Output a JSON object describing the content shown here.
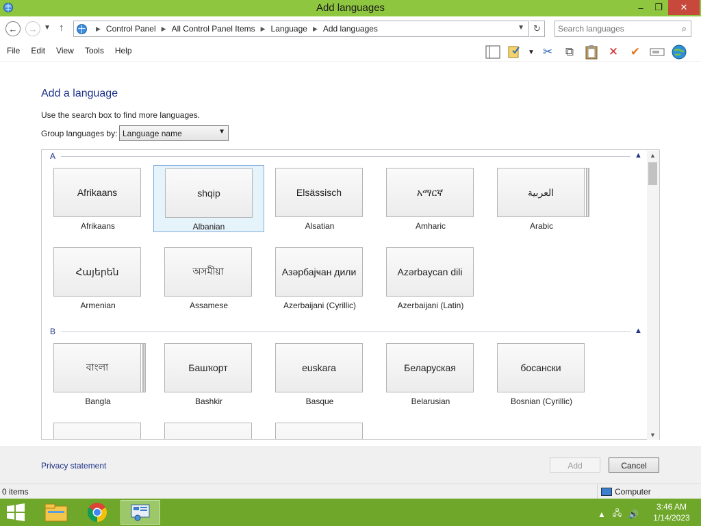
{
  "window": {
    "title": "Add languages",
    "minimize": "–",
    "maximize": "❐",
    "close": "✕"
  },
  "nav": {
    "breadcrumbs": [
      "Control Panel",
      "All Control Panel Items",
      "Language",
      "Add languages"
    ],
    "search_placeholder": "Search languages"
  },
  "menu": [
    "File",
    "Edit",
    "View",
    "Tools",
    "Help"
  ],
  "page": {
    "heading": "Add a language",
    "hint": "Use the search box to find more languages.",
    "group_label": "Group languages by:",
    "group_value": "Language name"
  },
  "groups": [
    {
      "letter": "A",
      "languages": [
        {
          "native": "Afrikaans",
          "name": "Afrikaans",
          "selected": false,
          "stacked": false
        },
        {
          "native": "shqip",
          "name": "Albanian",
          "selected": true,
          "stacked": false
        },
        {
          "native": "Elsässisch",
          "name": "Alsatian",
          "selected": false,
          "stacked": false
        },
        {
          "native": "አማርኛ",
          "name": "Amharic",
          "selected": false,
          "stacked": false
        },
        {
          "native": "العربية",
          "name": "Arabic",
          "selected": false,
          "stacked": true
        },
        {
          "native": "Հայերեն",
          "name": "Armenian",
          "selected": false,
          "stacked": false
        },
        {
          "native": "অসমীয়া",
          "name": "Assamese",
          "selected": false,
          "stacked": false
        },
        {
          "native": "Азәрбајҹан дили",
          "name": "Azerbaijani (Cyrillic)",
          "selected": false,
          "stacked": false
        },
        {
          "native": "Azərbaycan dili",
          "name": "Azerbaijani (Latin)",
          "selected": false,
          "stacked": false
        }
      ]
    },
    {
      "letter": "B",
      "languages": [
        {
          "native": "বাংলা",
          "name": "Bangla",
          "selected": false,
          "stacked": true
        },
        {
          "native": "Башҡорт",
          "name": "Bashkir",
          "selected": false,
          "stacked": false
        },
        {
          "native": "euskara",
          "name": "Basque",
          "selected": false,
          "stacked": false
        },
        {
          "native": "Беларуская",
          "name": "Belarusian",
          "selected": false,
          "stacked": false
        },
        {
          "native": "босански",
          "name": "Bosnian (Cyrillic)",
          "selected": false,
          "stacked": false
        },
        {
          "native": "",
          "name": "",
          "selected": false,
          "stacked": false
        },
        {
          "native": "",
          "name": "",
          "selected": false,
          "stacked": false
        },
        {
          "native": "",
          "name": "",
          "selected": false,
          "stacked": false
        }
      ]
    }
  ],
  "footer": {
    "privacy": "Privacy statement",
    "add": "Add",
    "cancel": "Cancel"
  },
  "status": {
    "items": "0 items",
    "location": "Computer"
  },
  "clock": {
    "time": "3:46 AM",
    "date": "1/14/2023"
  },
  "colors": {
    "titlebar": "#8ec63f",
    "taskbar": "#6fa72b",
    "accent_text": "#1e3287",
    "selection": "#e5f3fb"
  },
  "icons": [
    "back-arrow-icon",
    "forward-arrow-icon",
    "up-arrow-icon",
    "globe-icon",
    "refresh-icon",
    "search-icon",
    "layout-icon",
    "properties-icon",
    "cut-icon",
    "copy-icon",
    "paste-icon",
    "delete-icon",
    "check-icon",
    "rename-icon",
    "world-icon"
  ]
}
